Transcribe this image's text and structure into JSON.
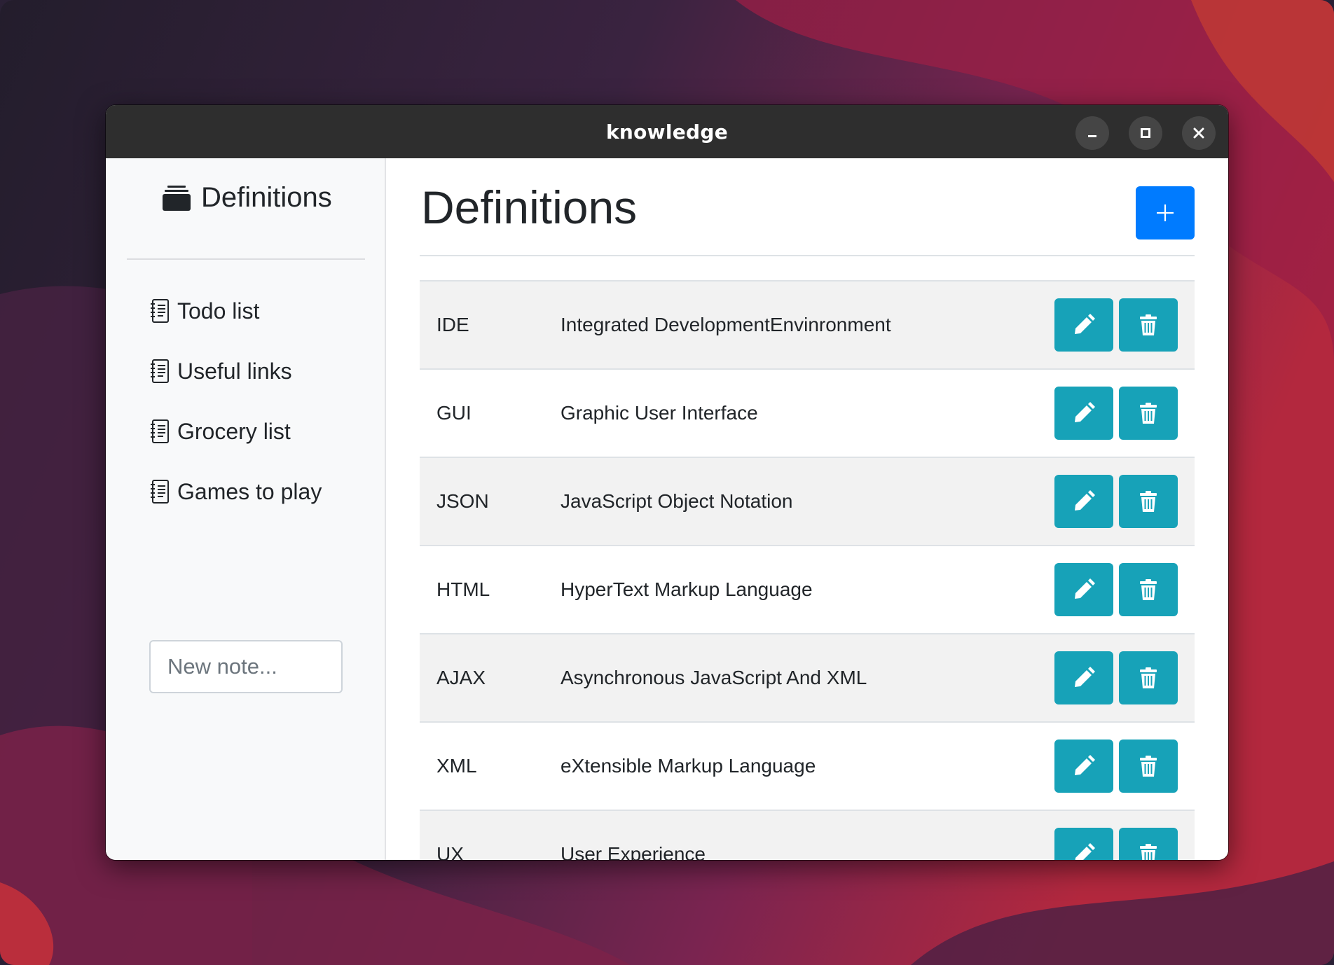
{
  "window": {
    "title": "knowledge"
  },
  "sidebar": {
    "brand": "Definitions",
    "items": [
      {
        "label": "Todo list"
      },
      {
        "label": "Useful links"
      },
      {
        "label": "Grocery list"
      },
      {
        "label": "Games to play"
      }
    ],
    "new_note_placeholder": "New note..."
  },
  "main": {
    "title": "Definitions",
    "rows": [
      {
        "term": "IDE",
        "definition": "Integrated DevelopmentEnvinronment"
      },
      {
        "term": "GUI",
        "definition": "Graphic User Interface"
      },
      {
        "term": "JSON",
        "definition": "JavaScript Object Notation"
      },
      {
        "term": "HTML",
        "definition": "HyperText Markup Language"
      },
      {
        "term": "AJAX",
        "definition": "Asynchronous JavaScript And XML"
      },
      {
        "term": "XML",
        "definition": "eXtensible Markup Language"
      },
      {
        "term": "UX",
        "definition": "User Experience"
      }
    ]
  },
  "colors": {
    "primary": "#007bff",
    "info": "#17a2b8",
    "titlebar": "#2e2e2e",
    "sidebar_bg": "#f8f9fa"
  },
  "icons": {
    "brand": "folder-stack-icon",
    "nav": "journal-icon",
    "add": "plus-icon",
    "edit": "pencil-icon",
    "delete": "trash-icon"
  }
}
